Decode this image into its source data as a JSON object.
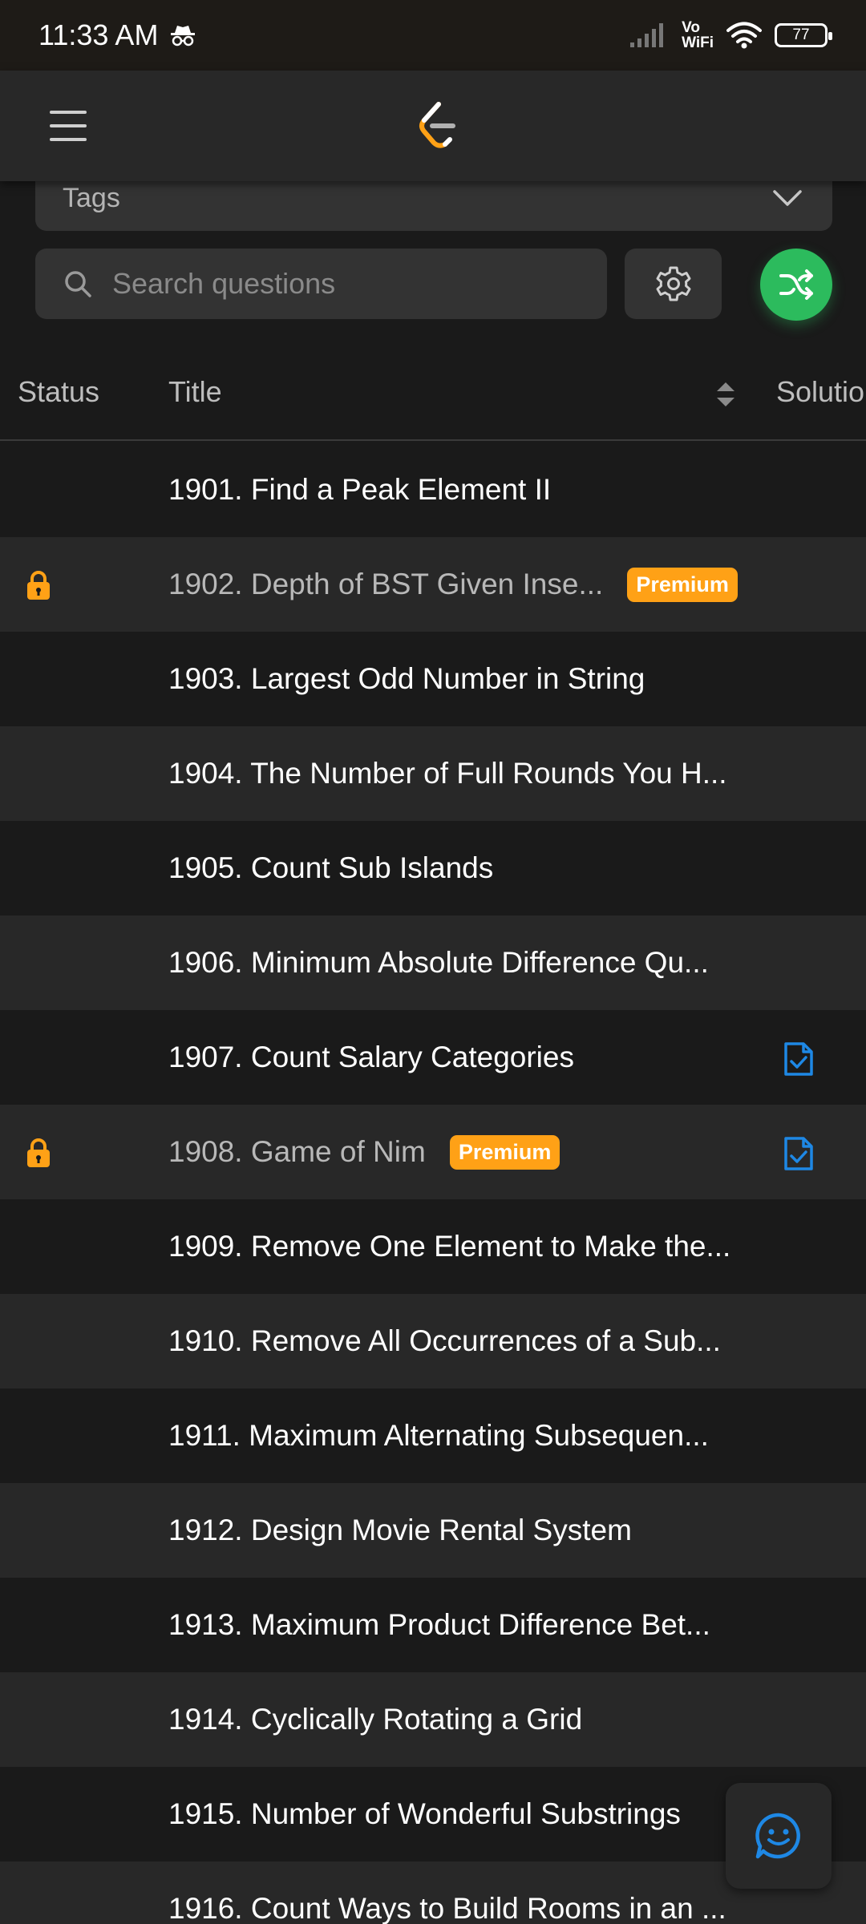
{
  "status_bar": {
    "time": "11:33 AM",
    "network_label_top": "Vo",
    "network_label_bottom": "WiFi",
    "battery": "77"
  },
  "header": {
    "logo_icon": "leetcode-logo-icon",
    "menu_icon": "hamburger-menu-icon"
  },
  "filters": {
    "tags_label": "Tags",
    "search_placeholder": "Search questions"
  },
  "colors": {
    "accent_green": "#2cbb5d",
    "premium_orange": "#ffa116",
    "solution_blue": "#1e88e5"
  },
  "table": {
    "headers": {
      "status": "Status",
      "title": "Title",
      "solution": "Solutio"
    },
    "rows": [
      {
        "title": "1901. Find a Peak Element II",
        "locked": false,
        "premium": "",
        "solution": false
      },
      {
        "title": "1902. Depth of BST Given Inse...",
        "locked": true,
        "premium": "Premium",
        "solution": false
      },
      {
        "title": "1903. Largest Odd Number in String",
        "locked": false,
        "premium": "",
        "solution": false
      },
      {
        "title": "1904. The Number of Full Rounds You H...",
        "locked": false,
        "premium": "",
        "solution": false
      },
      {
        "title": "1905. Count Sub Islands",
        "locked": false,
        "premium": "",
        "solution": false
      },
      {
        "title": "1906. Minimum Absolute Difference Qu...",
        "locked": false,
        "premium": "",
        "solution": false
      },
      {
        "title": "1907. Count Salary Categories",
        "locked": false,
        "premium": "",
        "solution": true
      },
      {
        "title": "1908. Game of Nim",
        "locked": true,
        "premium": "Premium",
        "solution": true
      },
      {
        "title": "1909. Remove One Element to Make the...",
        "locked": false,
        "premium": "",
        "solution": false
      },
      {
        "title": "1910. Remove All Occurrences of a Sub...",
        "locked": false,
        "premium": "",
        "solution": false
      },
      {
        "title": "1911. Maximum Alternating Subsequen...",
        "locked": false,
        "premium": "",
        "solution": false
      },
      {
        "title": "1912. Design Movie Rental System",
        "locked": false,
        "premium": "",
        "solution": false
      },
      {
        "title": "1913. Maximum Product Difference Bet...",
        "locked": false,
        "premium": "",
        "solution": false
      },
      {
        "title": "1914. Cyclically Rotating a Grid",
        "locked": false,
        "premium": "",
        "solution": false
      },
      {
        "title": "1915. Number of Wonderful Substrings",
        "locked": false,
        "premium": "",
        "solution": false
      },
      {
        "title": "1916. Count Ways to Build Rooms in an ...",
        "locked": false,
        "premium": "",
        "solution": false
      }
    ]
  }
}
